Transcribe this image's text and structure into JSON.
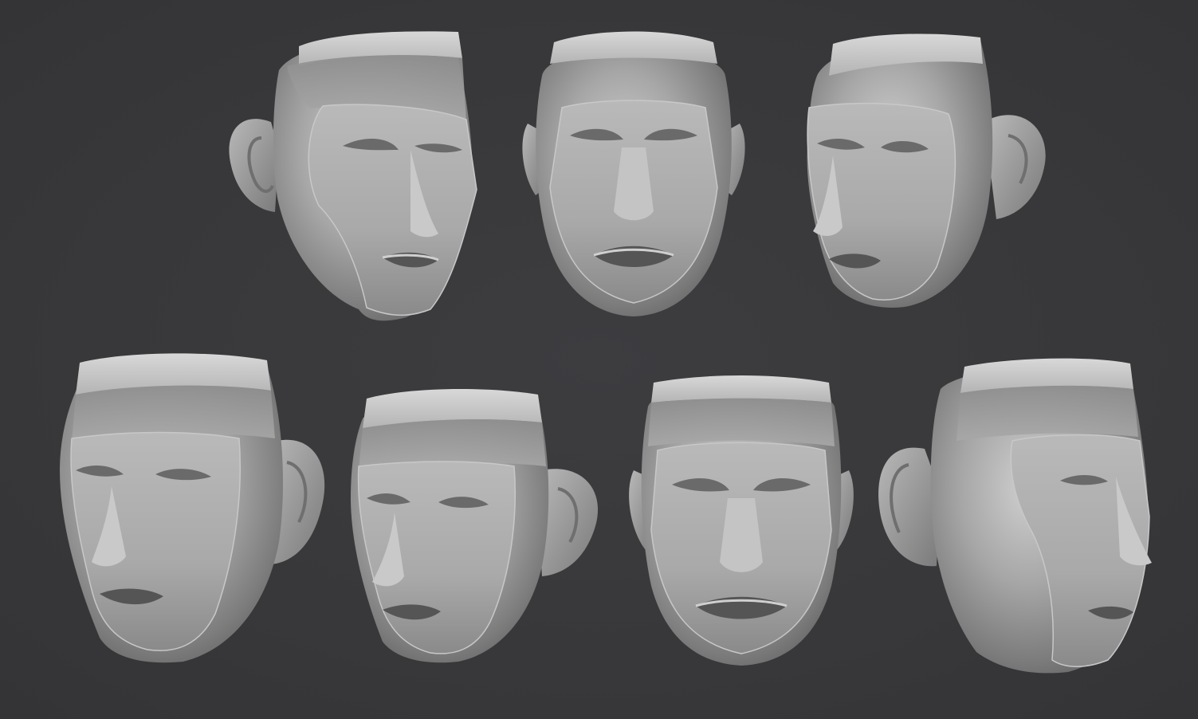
{
  "scene": {
    "background_color": "#39393b",
    "material_color": "#9c9c9c",
    "heads": [
      {
        "view": "three-quarter-right"
      },
      {
        "view": "front"
      },
      {
        "view": "three-quarter-left"
      },
      {
        "view": "three-quarter-right-low"
      },
      {
        "view": "three-quarter-right-low"
      },
      {
        "view": "front-low"
      },
      {
        "view": "profile-left"
      }
    ]
  }
}
